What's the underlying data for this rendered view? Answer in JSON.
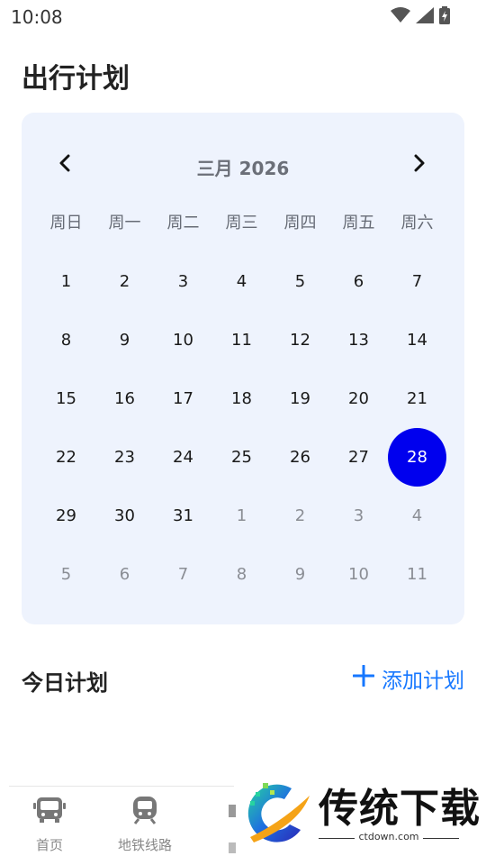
{
  "status_bar": {
    "time": "10:08"
  },
  "page": {
    "title": "出行计划"
  },
  "calendar": {
    "month_label": "三月 2026",
    "weekdays": [
      "周日",
      "周一",
      "周二",
      "周三",
      "周四",
      "周五",
      "周六"
    ],
    "days": [
      {
        "n": "1",
        "muted": false
      },
      {
        "n": "2",
        "muted": false
      },
      {
        "n": "3",
        "muted": false
      },
      {
        "n": "4",
        "muted": false
      },
      {
        "n": "5",
        "muted": false
      },
      {
        "n": "6",
        "muted": false
      },
      {
        "n": "7",
        "muted": false
      },
      {
        "n": "8",
        "muted": false
      },
      {
        "n": "9",
        "muted": false
      },
      {
        "n": "10",
        "muted": false
      },
      {
        "n": "11",
        "muted": false
      },
      {
        "n": "12",
        "muted": false
      },
      {
        "n": "13",
        "muted": false
      },
      {
        "n": "14",
        "muted": false
      },
      {
        "n": "15",
        "muted": false
      },
      {
        "n": "16",
        "muted": false
      },
      {
        "n": "17",
        "muted": false
      },
      {
        "n": "18",
        "muted": false
      },
      {
        "n": "19",
        "muted": false
      },
      {
        "n": "20",
        "muted": false
      },
      {
        "n": "21",
        "muted": false
      },
      {
        "n": "22",
        "muted": false
      },
      {
        "n": "23",
        "muted": false
      },
      {
        "n": "24",
        "muted": false
      },
      {
        "n": "25",
        "muted": false
      },
      {
        "n": "26",
        "muted": false
      },
      {
        "n": "27",
        "muted": false
      },
      {
        "n": "28",
        "muted": false,
        "selected": true
      },
      {
        "n": "29",
        "muted": false
      },
      {
        "n": "30",
        "muted": false
      },
      {
        "n": "31",
        "muted": false
      },
      {
        "n": "1",
        "muted": true
      },
      {
        "n": "2",
        "muted": true
      },
      {
        "n": "3",
        "muted": true
      },
      {
        "n": "4",
        "muted": true
      },
      {
        "n": "5",
        "muted": true
      },
      {
        "n": "6",
        "muted": true
      },
      {
        "n": "7",
        "muted": true
      },
      {
        "n": "8",
        "muted": true
      },
      {
        "n": "9",
        "muted": true
      },
      {
        "n": "10",
        "muted": true
      },
      {
        "n": "11",
        "muted": true
      }
    ],
    "prev_icon": "chevron-left-icon",
    "next_icon": "chevron-right-icon",
    "selected_color": "#0000ee",
    "card_color": "#eef3fd"
  },
  "today": {
    "title": "今日计划",
    "add_label": "添加计划",
    "add_icon": "plus-icon",
    "accent": "#1677ff"
  },
  "bottom_nav": {
    "items": [
      {
        "label": "首页",
        "icon": "bus-icon"
      },
      {
        "label": "地铁线路",
        "icon": "subway-train-icon"
      }
    ]
  },
  "watermark": {
    "brand": "传统下载",
    "url": "ctdown.com"
  }
}
